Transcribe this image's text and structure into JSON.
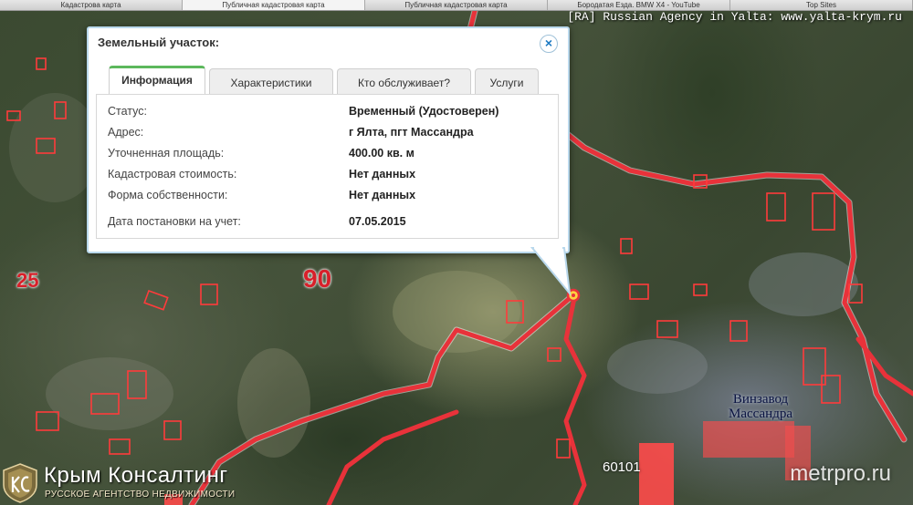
{
  "browser": {
    "tabs": [
      "Кадастрова карта",
      "Публичная кадастровая карта",
      "Публичная кадастровая карта",
      "Бородатая Езда. BMW X4 - YouTube",
      "Top Sites"
    ],
    "active_tab": 1
  },
  "overlay": {
    "agency_text": "[RA] Russian Agency in Yalta: www.yalta-krym.ru",
    "watermark": "metrpro.ru"
  },
  "map": {
    "labels": {
      "block_25": "25",
      "block_90": "90",
      "parcel_60101": "60101",
      "winery_line1": "Винзавод",
      "winery_line2": "Массандра"
    },
    "colors": {
      "boundary": "#e8323a",
      "parcel_fill": "#ff4b4b"
    }
  },
  "logo": {
    "title": "Крым Консалтинг",
    "subtitle": "РУССКОЕ АГЕНТСТВО НЕДВИЖИМОСТИ"
  },
  "popup": {
    "title": "Земельный участок:",
    "close_icon": "close-icon",
    "tabs": [
      {
        "label": "Информация",
        "active": true
      },
      {
        "label": "Характеристики",
        "active": false
      },
      {
        "label": "Кто обслуживает?",
        "active": false
      },
      {
        "label": "Услуги",
        "active": false
      }
    ],
    "rows": [
      {
        "key": "Статус:",
        "value": "Временный (Удостоверен)"
      },
      {
        "key": "Адрес:",
        "value": "г Ялта, пгт Массандра"
      },
      {
        "key": "Уточненная площадь:",
        "value": "400.00 кв. м"
      },
      {
        "key": "Кадастровая стоимость:",
        "value": "Нет данных"
      },
      {
        "key": "Форма собственности:",
        "value": "Нет данных"
      },
      {
        "key": "Дата постановки на учет:",
        "value": "07.05.2015"
      }
    ],
    "accent_color": "#5cb85c"
  }
}
